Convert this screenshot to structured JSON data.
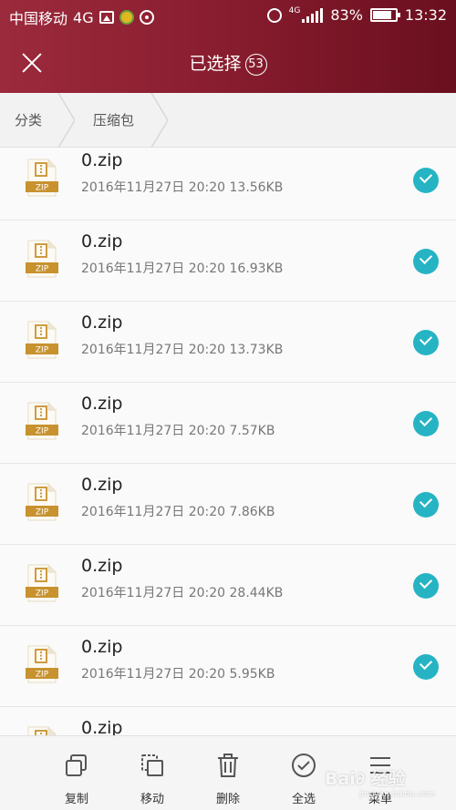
{
  "status_bar": {
    "carrier": "中国移动",
    "network": "4G",
    "net_small": "4G",
    "battery": "83%",
    "battery_level": 0.83,
    "time": "13:32"
  },
  "header": {
    "close_icon": "close-icon",
    "title": "已选择",
    "count": "53"
  },
  "breadcrumb": {
    "items": [
      "分类",
      "压缩包"
    ]
  },
  "files": [
    {
      "name": "0.zip",
      "meta": "2016年11月27日 20:20 13.56KB",
      "icon_label": "ZIP",
      "checked": true
    },
    {
      "name": "0.zip",
      "meta": "2016年11月27日 20:20 16.93KB",
      "icon_label": "ZIP",
      "checked": true
    },
    {
      "name": "0.zip",
      "meta": "2016年11月27日 20:20 13.73KB",
      "icon_label": "ZIP",
      "checked": true
    },
    {
      "name": "0.zip",
      "meta": "2016年11月27日 20:20 7.57KB",
      "icon_label": "ZIP",
      "checked": true
    },
    {
      "name": "0.zip",
      "meta": "2016年11月27日 20:20 7.86KB",
      "icon_label": "ZIP",
      "checked": true
    },
    {
      "name": "0.zip",
      "meta": "2016年11月27日 20:20 28.44KB",
      "icon_label": "ZIP",
      "checked": true
    },
    {
      "name": "0.zip",
      "meta": "2016年11月27日 20:20 5.95KB",
      "icon_label": "ZIP",
      "checked": true
    },
    {
      "name": "0.zip",
      "meta": "",
      "icon_label": "ZIP",
      "checked": false
    }
  ],
  "bottom_bar": {
    "copy": "复制",
    "move": "移动",
    "delete": "删除",
    "select_all": "全选",
    "menu": "菜单"
  },
  "watermark": {
    "text": "Bai∂ 经验",
    "sub": "jingyan.baidu.com"
  },
  "colors": {
    "header_gradient_start": "#9b2a3c",
    "header_gradient_end": "#6a0f1e",
    "check_accent": "#26b4c4",
    "zip_icon": "#c8922e"
  }
}
